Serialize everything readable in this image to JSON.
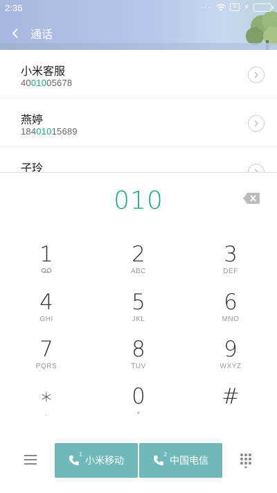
{
  "status_bar": {
    "time": "2:36",
    "dots": "···",
    "battery_bolt": "⚡"
  },
  "nav": {
    "title": "通话"
  },
  "results": [
    {
      "name": "小米客服",
      "number_pre": "40",
      "number_match": "010",
      "number_post": "05678"
    },
    {
      "name": "燕婷",
      "number_pre": "184",
      "number_match": "010",
      "number_post": "15689"
    },
    {
      "name": "子玲",
      "number_pre": "",
      "number_match": "",
      "number_post": ""
    }
  ],
  "dialpad": {
    "display_number": "010",
    "keys": [
      {
        "digit": "1",
        "sub": ""
      },
      {
        "digit": "2",
        "sub": "ABC"
      },
      {
        "digit": "3",
        "sub": "DEF"
      },
      {
        "digit": "4",
        "sub": "GHI"
      },
      {
        "digit": "5",
        "sub": "JKL"
      },
      {
        "digit": "6",
        "sub": "MNO"
      },
      {
        "digit": "7",
        "sub": "PQRS"
      },
      {
        "digit": "8",
        "sub": "TUV"
      },
      {
        "digit": "9",
        "sub": "WXYZ"
      },
      {
        "digit": "∗",
        "sub": ","
      },
      {
        "digit": "0",
        "sub": "+"
      },
      {
        "digit": "#",
        "sub": ""
      }
    ]
  },
  "bottom_bar": {
    "sim1": {
      "label": "小米移动",
      "slot": "1"
    },
    "sim2": {
      "label": "中国电信",
      "slot": "2"
    }
  },
  "colors": {
    "accent": "#1ba58a",
    "sim_button": "#6fb9bb",
    "header": "#b3c1e6"
  }
}
